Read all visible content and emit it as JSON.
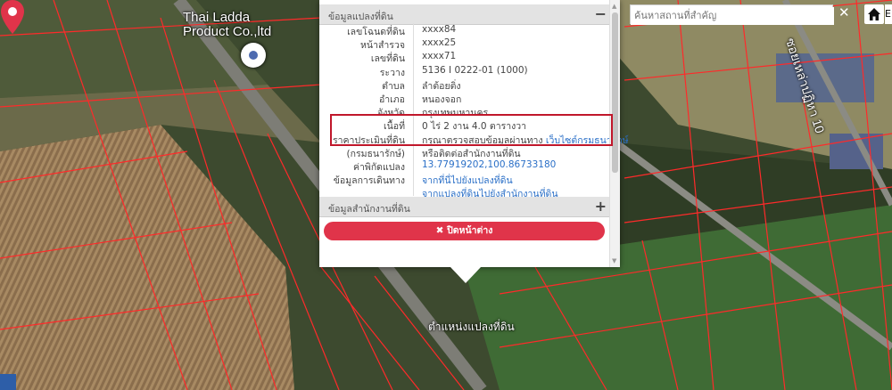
{
  "map": {
    "poi_name_line1": "Thai Ladda",
    "poi_name_line2": "Product Co.,ltd",
    "road_name": "ซอยเหล่าปฏิหา 10",
    "pin_label": "ตำแหน่งแปลงที่ดิน"
  },
  "popup": {
    "section1_title": "ข้อมูลแปลงที่ดิน",
    "section1_toggle": "−",
    "rows": [
      {
        "key": "เลขโฉนดที่ดิน",
        "value": "xxxx84"
      },
      {
        "key": "หน้าสำรวจ",
        "value": "xxxx25"
      },
      {
        "key": "เลขที่ดิน",
        "value": "xxxx71"
      },
      {
        "key": "ระวาง",
        "value": "5136 I 0222-01 (1000)"
      },
      {
        "key": "ตำบล",
        "value": "ลำต้อยติ่ง"
      },
      {
        "key": "อำเภอ",
        "value": "หนองจอก"
      },
      {
        "key": "จังหวัด",
        "value": "กรุงเทพมหานคร"
      },
      {
        "key": "เนื้อที่",
        "value": "0 ไร่ 2 งาน 4.0 ตารางวา"
      },
      {
        "key": "ราคาประเมินที่ดิน",
        "value": "กรุณาตรวจสอบข้อมูลผ่านทาง",
        "link": "เว็บไซต์กรมธนารักษ์"
      },
      {
        "key": "(กรมธนารักษ์)",
        "value": "หรือติดต่อสำนักงานที่ดิน"
      },
      {
        "key": "ค่าพิกัดแปลง",
        "link": "13.77919202,100.86733180"
      },
      {
        "key": "ข้อมูลการเดินทาง",
        "link": "จากที่นี่ไปยังแปลงที่ดิน"
      },
      {
        "key": "",
        "link": "จากแปลงที่ดินไปยังสำนักงานที่ดิน"
      }
    ],
    "section2_title": "ข้อมูลสำนักงานที่ดิน",
    "section2_toggle": "+",
    "close_label": "✖ ปิดหน้าต่าง"
  },
  "search": {
    "placeholder": "ค้นหาสถานที่สำคัญ",
    "clear_label": "✕",
    "edge_label": "E"
  },
  "colors": {
    "highlight": "#c0172b",
    "close_button": "#e0344a",
    "link": "#2a6fc7",
    "pin": "#e0344a",
    "parcel_lines": "#ff2a2a"
  }
}
